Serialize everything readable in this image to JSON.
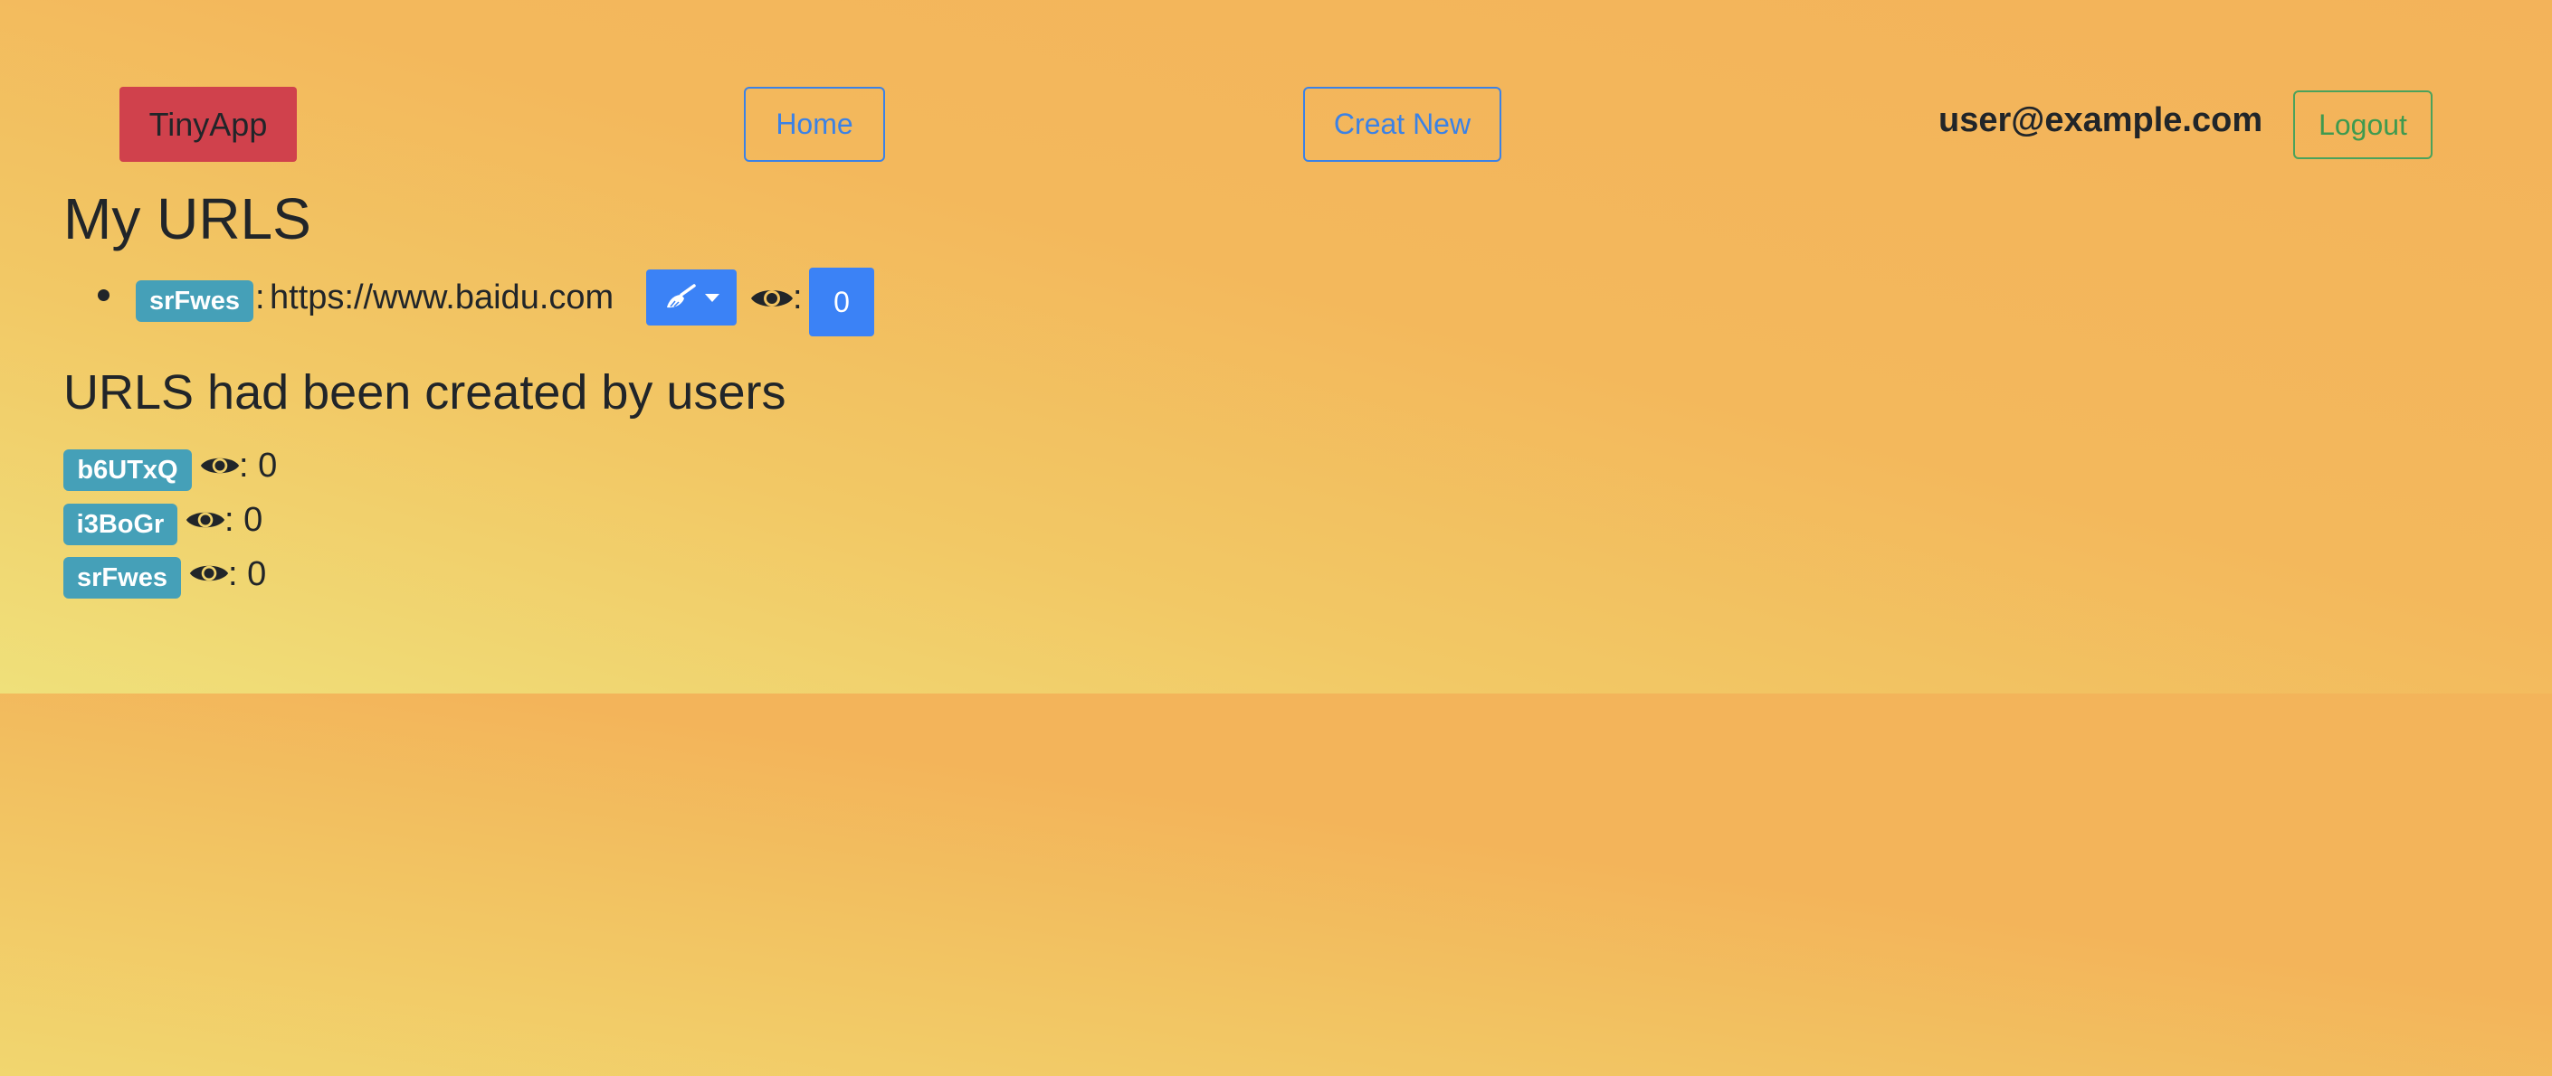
{
  "nav": {
    "brand": "TinyApp",
    "home_label": "Home",
    "create_label": "Creat New",
    "user_email": "user@example.com",
    "logout_label": "Logout"
  },
  "my_urls": {
    "heading": "My URLS",
    "items": [
      {
        "short_id": "srFwes",
        "separator": ":",
        "long_url": "https://www.baidu.com",
        "edit_icon": "broom-icon",
        "views_icon": "eye-icon",
        "views_separator": ":",
        "views": "0"
      }
    ]
  },
  "all_urls": {
    "heading": "URLS had been created by users",
    "items": [
      {
        "short_id": "b6UTxQ",
        "views_label": ": 0"
      },
      {
        "short_id": "i3BoGr",
        "views_label": ": 0"
      },
      {
        "short_id": "srFwes",
        "views_label": ": 0"
      }
    ]
  },
  "colors": {
    "brand_bg": "#d0414c",
    "primary": "#3b82f6",
    "success": "#3e9a4f",
    "badge_info": "#45a0b8"
  }
}
